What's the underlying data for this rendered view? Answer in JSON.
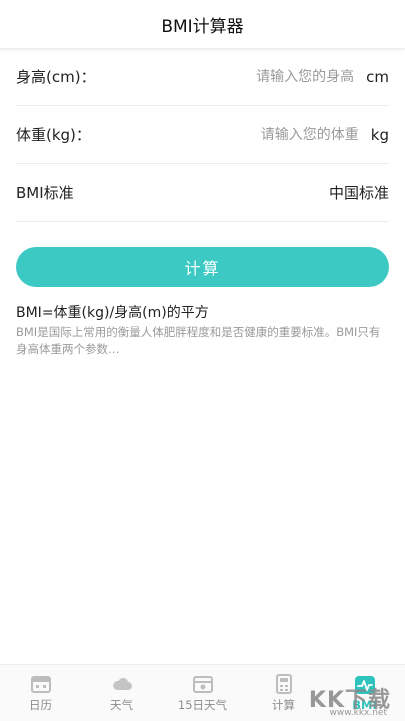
{
  "header": {
    "title": "BMI计算器"
  },
  "form": {
    "height": {
      "label": "身高(cm)：",
      "placeholder": "请输入您的身高",
      "unit": "cm"
    },
    "weight": {
      "label": "体重(kg)：",
      "placeholder": "请输入您的体重",
      "unit": "kg"
    },
    "standard": {
      "label": "BMI标准",
      "value": "中国标准"
    }
  },
  "calc_button": {
    "label": "计算"
  },
  "info": {
    "formula": "BMI=体重(kg)/身高(m)的平方",
    "description": "BMI是国际上常用的衡量人体肥胖程度和是否健康的重要标准。BMI只有身高体重两个参数…"
  },
  "tabbar": {
    "items": [
      {
        "label": "日历",
        "icon": "calendar-icon"
      },
      {
        "label": "天气",
        "icon": "cloud-icon"
      },
      {
        "label": "15日天气",
        "icon": "forecast-icon"
      },
      {
        "label": "计算",
        "icon": "calculator-icon"
      },
      {
        "label": "BMI",
        "icon": "heartbeat-icon",
        "active": true
      }
    ]
  },
  "watermark": {
    "text": "KK下载",
    "url": "www.kkx.net"
  },
  "colors": {
    "accent": "#3cc9c4",
    "tab_active": "#2ec3bc",
    "muted": "#9a9a9a"
  }
}
